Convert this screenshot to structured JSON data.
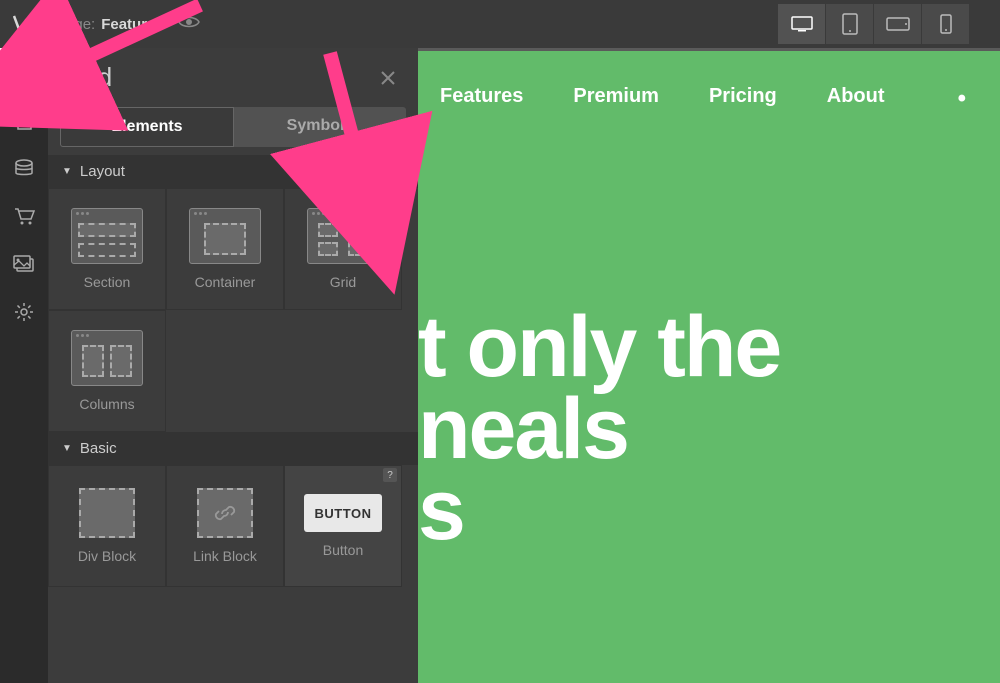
{
  "topbar": {
    "page_label": "Page:",
    "page_name": "Features"
  },
  "panel": {
    "title": "Add",
    "tabs": {
      "elements": "Elements",
      "symbols": "Symbols"
    }
  },
  "sections": {
    "layout": {
      "title": "Layout",
      "items": {
        "section": "Section",
        "container": "Container",
        "grid": "Grid",
        "columns": "Columns"
      }
    },
    "basic": {
      "title": "Basic",
      "items": {
        "divblock": "Div Block",
        "linkblock": "Link Block",
        "button": "Button",
        "button_text": "BUTTON"
      }
    }
  },
  "canvas": {
    "nav": {
      "features": "Features",
      "premium": "Premium",
      "pricing": "Pricing",
      "about": "About",
      "more": "•"
    },
    "hero_line1": "t only the",
    "hero_line2": "neals",
    "hero_line3": "s"
  },
  "help": "?"
}
